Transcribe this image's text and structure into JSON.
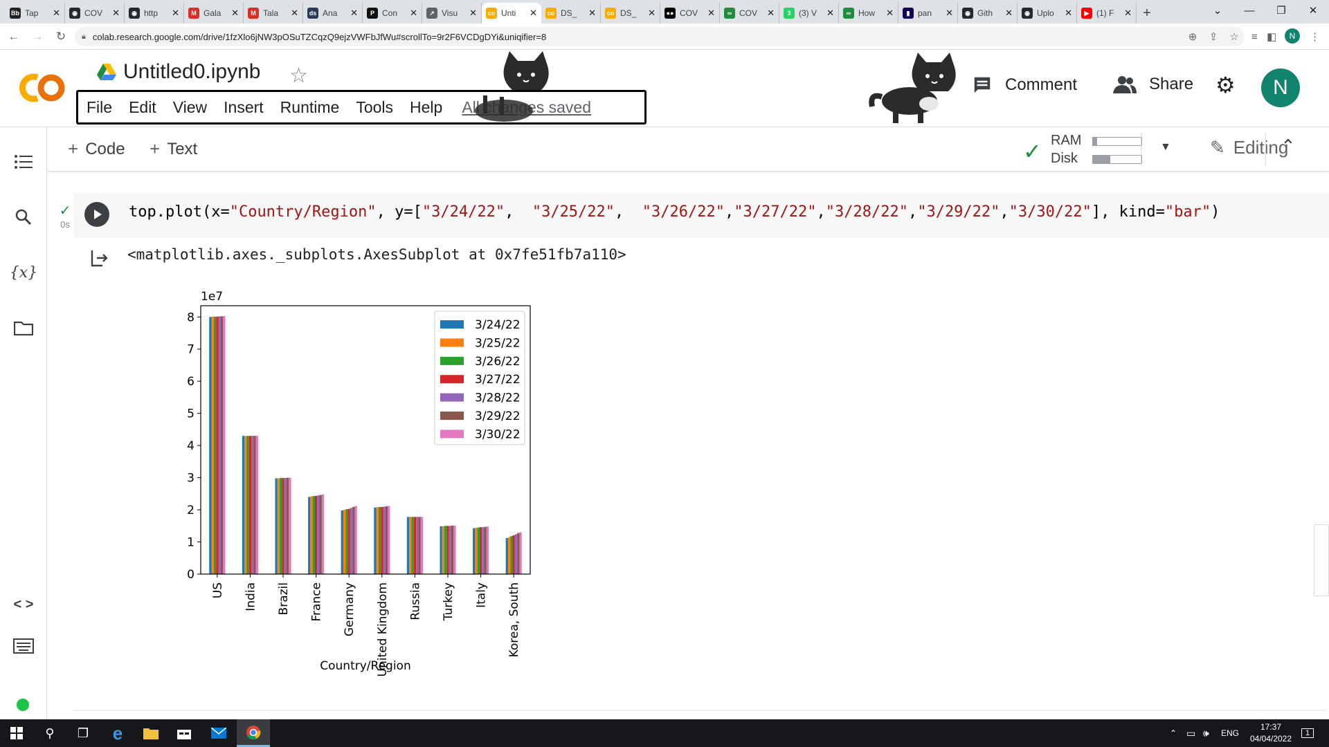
{
  "browser": {
    "tabs": [
      {
        "label": "Tap",
        "icon": "bb-icon",
        "color": "#222222",
        "glyph": "Bb"
      },
      {
        "label": "COV",
        "icon": "github-icon",
        "color": "#24292e",
        "glyph": "◉"
      },
      {
        "label": "http",
        "icon": "github-icon",
        "color": "#24292e",
        "glyph": "◉"
      },
      {
        "label": "Gala",
        "icon": "gmail-icon",
        "color": "#d93025",
        "glyph": "M"
      },
      {
        "label": "Tala",
        "icon": "gmail-icon",
        "color": "#d93025",
        "glyph": "M"
      },
      {
        "label": "Ana",
        "icon": "ads-icon",
        "color": "#2b3a55",
        "glyph": "ds"
      },
      {
        "label": "Con",
        "icon": "p-icon",
        "color": "#111111",
        "glyph": "P"
      },
      {
        "label": "Visu",
        "icon": "chart-icon",
        "color": "#5f6368",
        "glyph": "↗"
      },
      {
        "label": "Unti",
        "icon": "colab-icon",
        "color": "#f9ab00",
        "glyph": "co"
      },
      {
        "label": "DS_",
        "icon": "colab-icon",
        "color": "#f9ab00",
        "glyph": "co"
      },
      {
        "label": "DS_",
        "icon": "colab-icon",
        "color": "#f9ab00",
        "glyph": "co"
      },
      {
        "label": "COV",
        "icon": "medium-icon",
        "color": "#000000",
        "glyph": "●●"
      },
      {
        "label": "COV",
        "icon": "link-icon",
        "color": "#1e8e3e",
        "glyph": "∞"
      },
      {
        "label": "(3) V",
        "icon": "whatsapp-icon",
        "color": "#25d366",
        "glyph": "3"
      },
      {
        "label": "How",
        "icon": "link-icon",
        "color": "#1e8e3e",
        "glyph": "∞"
      },
      {
        "label": "pan",
        "icon": "pandas-icon",
        "color": "#150458",
        "glyph": "▮"
      },
      {
        "label": "Gith",
        "icon": "github-icon",
        "color": "#24292e",
        "glyph": "◉"
      },
      {
        "label": "Uplo",
        "icon": "github-icon",
        "color": "#24292e",
        "glyph": "◉"
      },
      {
        "label": "(1) F",
        "icon": "youtube-icon",
        "color": "#ff0000",
        "glyph": "▶"
      }
    ],
    "active_tab_index": 8,
    "url": "colab.research.google.com/drive/1fzXlo6jNW3pOSuTZCqzQ9ejzVWFbJfWu#scrollTo=9r2F6VCDgDYi&uniqifier=8",
    "profile_initial": "N"
  },
  "header": {
    "logo_text": "CO",
    "title": "Untitled0.ipynb",
    "menu": [
      "File",
      "Edit",
      "View",
      "Insert",
      "Runtime",
      "Tools",
      "Help"
    ],
    "save_status": "All changes saved",
    "comment_label": "Comment",
    "share_label": "Share",
    "avatar_initial": "N"
  },
  "toolbar": {
    "code_label": "Code",
    "text_label": "Text",
    "ram_label": "RAM",
    "disk_label": "Disk",
    "ram_usage": 0.08,
    "disk_usage": 0.35,
    "editing_label": "Editing"
  },
  "cell": {
    "exec_time": "0s",
    "code_parts": [
      {
        "t": "top.plot(x=",
        "s": false
      },
      {
        "t": "\"Country/Region\"",
        "s": true
      },
      {
        "t": ", y=[",
        "s": false
      },
      {
        "t": "\"3/24/22\"",
        "s": true
      },
      {
        "t": ",  ",
        "s": false
      },
      {
        "t": "\"3/25/22\"",
        "s": true
      },
      {
        "t": ",  ",
        "s": false
      },
      {
        "t": "\"3/26/22\"",
        "s": true
      },
      {
        "t": ",",
        "s": false
      },
      {
        "t": "\"3/27/22\"",
        "s": true
      },
      {
        "t": ",",
        "s": false
      },
      {
        "t": "\"3/28/22\"",
        "s": true
      },
      {
        "t": ",",
        "s": false
      },
      {
        "t": "\"3/29/22\"",
        "s": true
      },
      {
        "t": ",",
        "s": false
      },
      {
        "t": "\"3/30/22\"",
        "s": true
      },
      {
        "t": "], kind=",
        "s": false
      },
      {
        "t": "\"bar\"",
        "s": true
      },
      {
        "t": ")",
        "s": false
      }
    ],
    "output_text": "<matplotlib.axes._subplots.AxesSubplot at 0x7fe51fb7a110>"
  },
  "chart_data": {
    "type": "bar",
    "categories": [
      "US",
      "India",
      "Brazil",
      "France",
      "Germany",
      "United Kingdom",
      "Russia",
      "Turkey",
      "Italy",
      "Korea, South"
    ],
    "series": [
      {
        "name": "3/24/22",
        "color": "#1f77b4",
        "values": [
          8.0,
          4.3,
          2.98,
          2.4,
          1.98,
          2.07,
          1.78,
          1.49,
          1.43,
          1.12
        ]
      },
      {
        "name": "3/25/22",
        "color": "#ff7f0e",
        "values": [
          8.01,
          4.3,
          2.98,
          2.42,
          2.0,
          2.08,
          1.78,
          1.49,
          1.44,
          1.15
        ]
      },
      {
        "name": "3/26/22",
        "color": "#2ca02c",
        "values": [
          8.01,
          4.3,
          2.99,
          2.43,
          2.02,
          2.09,
          1.78,
          1.5,
          1.45,
          1.18
        ]
      },
      {
        "name": "3/27/22",
        "color": "#d62728",
        "values": [
          8.01,
          4.3,
          2.99,
          2.43,
          2.03,
          2.09,
          1.78,
          1.5,
          1.46,
          1.21
        ]
      },
      {
        "name": "3/28/22",
        "color": "#9467bd",
        "values": [
          8.02,
          4.3,
          2.99,
          2.45,
          2.06,
          2.1,
          1.78,
          1.5,
          1.46,
          1.24
        ]
      },
      {
        "name": "3/29/22",
        "color": "#8c564b",
        "values": [
          8.02,
          4.3,
          3.0,
          2.46,
          2.09,
          2.11,
          1.78,
          1.51,
          1.47,
          1.28
        ]
      },
      {
        "name": "3/30/22",
        "color": "#e377c2",
        "values": [
          8.03,
          4.3,
          3.0,
          2.48,
          2.12,
          2.12,
          1.78,
          1.51,
          1.48,
          1.3
        ]
      }
    ],
    "xlabel": "Country/Region",
    "ylabel": "",
    "y_multiplier": "1e7",
    "ylim": [
      0,
      8.35
    ],
    "yticks": [
      "0",
      "1",
      "2",
      "3",
      "4",
      "5",
      "6",
      "7",
      "8"
    ],
    "legend_position": "top-right",
    "grid": false
  },
  "taskbar": {
    "language": "ENG",
    "time": "17:37",
    "date": "04/04/2022",
    "notification_count": "1"
  }
}
